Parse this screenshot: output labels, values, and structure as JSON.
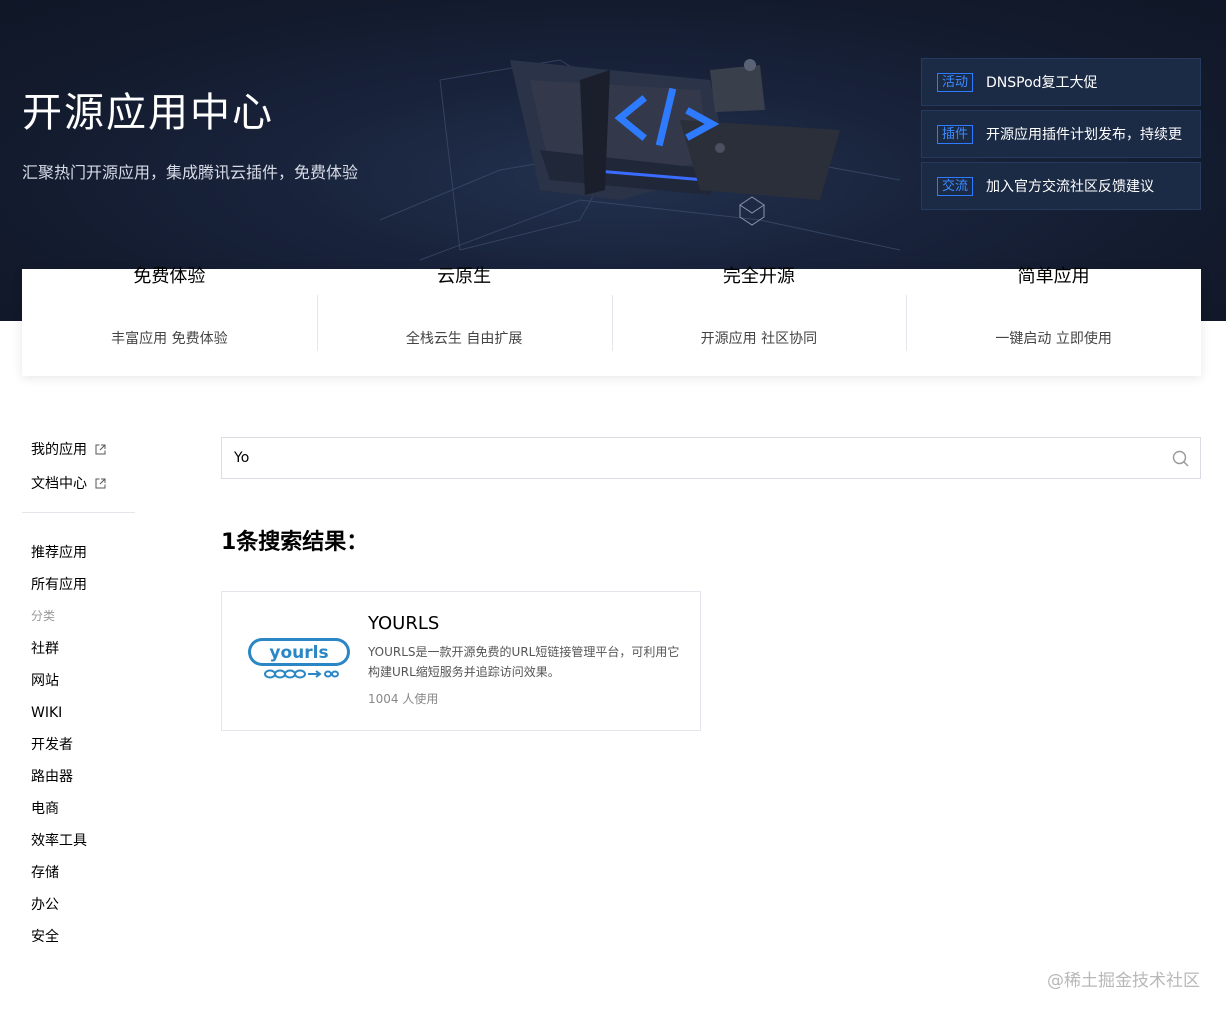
{
  "hero": {
    "title": "开源应用中心",
    "subtitle": "汇聚热门开源应用，集成腾讯云插件，免费体验",
    "notices": [
      {
        "tag": "活动",
        "text": "DNSPod复工大促"
      },
      {
        "tag": "插件",
        "text": "开源应用插件计划发布，持续更"
      },
      {
        "tag": "交流",
        "text": "加入官方交流社区反馈建议"
      }
    ]
  },
  "features": [
    {
      "title": "免费体验",
      "desc": "丰富应用 免费体验"
    },
    {
      "title": "云原生",
      "desc": "全栈云生 自由扩展"
    },
    {
      "title": "完全开源",
      "desc": "开源应用 社区协同"
    },
    {
      "title": "简单应用",
      "desc": "一键启动 立即使用"
    }
  ],
  "sidebar": {
    "links": [
      {
        "label": "我的应用",
        "icon": "external-link-icon"
      },
      {
        "label": "文档中心",
        "icon": "external-link-icon"
      }
    ],
    "main_items": [
      "推荐应用",
      "所有应用"
    ],
    "category_label": "分类",
    "categories": [
      "社群",
      "网站",
      "WIKI",
      "开发者",
      "路由器",
      "电商",
      "效率工具",
      "存储",
      "办公",
      "安全"
    ]
  },
  "search": {
    "value": "Yo",
    "icon": "search-icon"
  },
  "results": {
    "heading": "1条搜索结果：",
    "items": [
      {
        "name": "YOURLS",
        "logo_text": "yourls",
        "description": "YOURLS是一款开源免费的URL短链接管理平台，可利用它构建URL缩短服务并追踪访问效果。",
        "usage": "1004 人使用"
      }
    ]
  },
  "watermark": "@稀土掘金技术社区",
  "colors": {
    "hero_bg": "#121a2c",
    "notice_bg": "#1b2a45",
    "accent_blue": "#2f7bff",
    "logo_blue": "#2a86c4"
  }
}
